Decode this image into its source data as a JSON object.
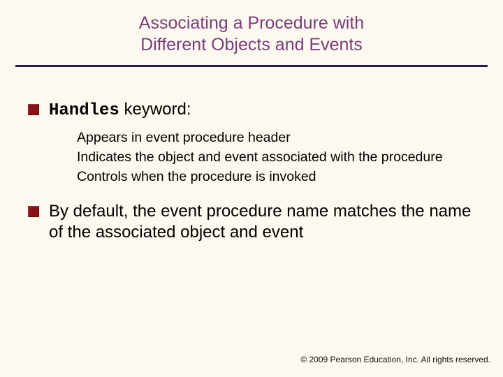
{
  "title": {
    "line1": "Associating a Procedure with",
    "line2": "Different Objects and Events"
  },
  "bullets": [
    {
      "mono": "Handles",
      "rest": " keyword:",
      "sub": [
        "Appears in event procedure header",
        "Indicates the object and event associated with the procedure",
        "Controls when the procedure is invoked"
      ]
    },
    {
      "mono": "",
      "rest": "By default, the event procedure name matches the name of the associated object and event",
      "sub": []
    }
  ],
  "footer": "© 2009 Pearson Education, Inc.  All rights reserved."
}
